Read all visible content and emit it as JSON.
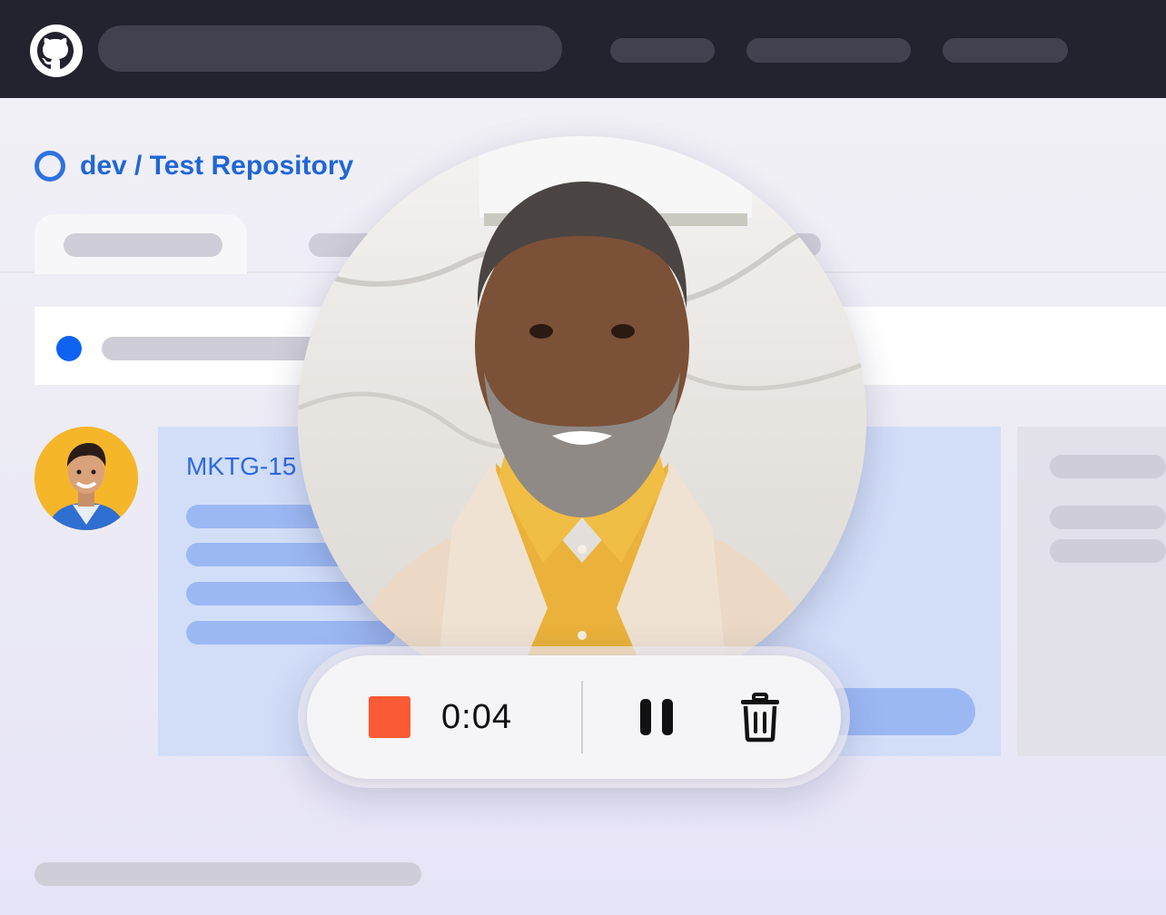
{
  "header": {
    "logo_icon": "github-icon",
    "bar_color": "#23222f"
  },
  "repo": {
    "title": "dev / Test Repository",
    "icon": "circle-ring-icon",
    "accent": "#1f66d6"
  },
  "issue": {
    "id_text": "MKTG-15",
    "card_color": "#d2def8"
  },
  "recorder": {
    "timer": "0:04",
    "stop_icon": "stop-icon",
    "pause_icon": "pause-icon",
    "delete_icon": "trash-icon",
    "stop_color": "#fb5b34"
  },
  "participants": {
    "avatar_icon": "user-avatar",
    "video_subject": "presenter-camera-feed"
  }
}
